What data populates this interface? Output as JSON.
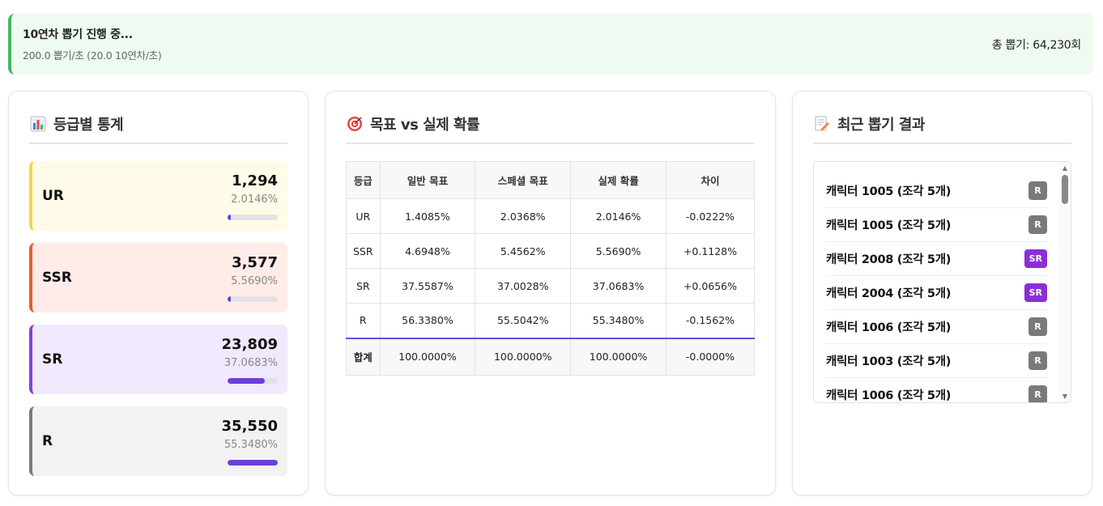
{
  "banner": {
    "title": "10연차 뽑기 진행 중...",
    "subtitle": "200.0 뽑기/초 (20.0 10연차/초)",
    "total": "총 뽑기: 64,230회"
  },
  "grade_panel": {
    "title": "등급별 통계",
    "icon": "bar-chart-icon",
    "grades": [
      {
        "name": "UR",
        "count": "1,294",
        "pct": "2.0146%",
        "fill": 0.02,
        "bg": "#fffbe8",
        "border": "#f5d63a"
      },
      {
        "name": "SSR",
        "count": "3,577",
        "pct": "5.5690%",
        "fill": 0.06,
        "bg": "#ffece9",
        "border": "#ef5a2a"
      },
      {
        "name": "SR",
        "count": "23,809",
        "pct": "37.0683%",
        "fill": 0.74,
        "bg": "#f1e9fd",
        "border": "#8a3fd8"
      },
      {
        "name": "R",
        "count": "35,550",
        "pct": "55.3480%",
        "fill": 1.0,
        "bg": "#f2f2f2",
        "border": "#7a7a7a"
      }
    ]
  },
  "prob_panel": {
    "title": "목표 vs 실제 확률",
    "icon": "target-icon",
    "headers": [
      "등급",
      "일반 목표",
      "스페셜 목표",
      "실제 확률",
      "차이"
    ],
    "rows": [
      {
        "grade": "UR",
        "normal": "1.4085%",
        "special": "2.0368%",
        "actual": "2.0146%",
        "diff": "-0.0222%",
        "sign": "neg"
      },
      {
        "grade": "SSR",
        "normal": "4.6948%",
        "special": "5.4562%",
        "actual": "5.5690%",
        "diff": "+0.1128%",
        "sign": "pos"
      },
      {
        "grade": "SR",
        "normal": "37.5587%",
        "special": "37.0028%",
        "actual": "37.0683%",
        "diff": "+0.0656%",
        "sign": "pos"
      },
      {
        "grade": "R",
        "normal": "56.3380%",
        "special": "55.5042%",
        "actual": "55.3480%",
        "diff": "-0.1562%",
        "sign": "neg"
      }
    ],
    "total": {
      "grade": "합계",
      "normal": "100.0000%",
      "special": "100.0000%",
      "actual": "100.0000%",
      "diff": "-0.0000%"
    }
  },
  "recent_panel": {
    "title": "최근 뽑기 결과",
    "icon": "memo-icon",
    "items": [
      {
        "name": "캐릭터 1005 (조각 5개)",
        "grade": "R",
        "color": "#7a7a7a"
      },
      {
        "name": "캐릭터 1005 (조각 5개)",
        "grade": "R",
        "color": "#7a7a7a"
      },
      {
        "name": "캐릭터 2008 (조각 5개)",
        "grade": "SR",
        "color": "#8a2fd8"
      },
      {
        "name": "캐릭터 2004 (조각 5개)",
        "grade": "SR",
        "color": "#8a2fd8"
      },
      {
        "name": "캐릭터 1006 (조각 5개)",
        "grade": "R",
        "color": "#7a7a7a"
      },
      {
        "name": "캐릭터 1003 (조각 5개)",
        "grade": "R",
        "color": "#7a7a7a"
      },
      {
        "name": "캐릭터 1006 (조각 5개)",
        "grade": "R",
        "color": "#7a7a7a"
      }
    ]
  }
}
